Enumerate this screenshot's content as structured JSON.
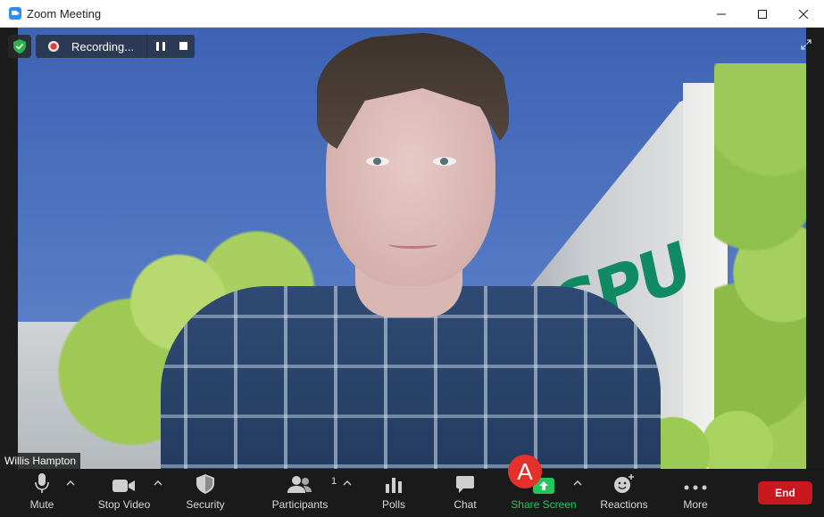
{
  "window": {
    "title": "Zoom Meeting"
  },
  "recording": {
    "label": "Recording..."
  },
  "video": {
    "participant_name": "Willis Hampton",
    "background_logo_text": "SPU"
  },
  "toolbar": {
    "mute_label": "Mute",
    "stop_video_label": "Stop Video",
    "security_label": "Security",
    "participants_label": "Participants",
    "participants_count": "1",
    "polls_label": "Polls",
    "chat_label": "Chat",
    "share_screen_label": "Share Screen",
    "reactions_label": "Reactions",
    "more_label": "More",
    "end_label": "End"
  },
  "annotation": {
    "marker_label": "A"
  },
  "colors": {
    "share_screen": "#22c55e",
    "end_button": "#c9181f",
    "recording_panel": "#2b3a55",
    "annotation_marker": "#e5302b"
  }
}
